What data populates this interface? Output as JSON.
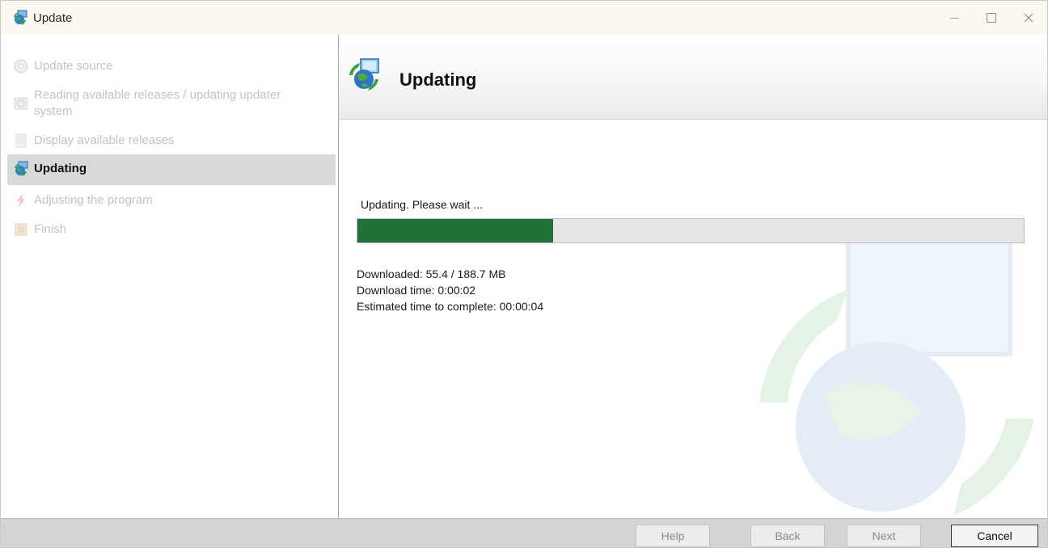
{
  "window": {
    "title": "Update"
  },
  "steps": [
    {
      "label": "Update source",
      "state": "disabled",
      "icon": "cd-icon"
    },
    {
      "label": "Reading available releases / updating updater system",
      "state": "disabled",
      "icon": "refresh-icon"
    },
    {
      "label": "Display available releases",
      "state": "disabled",
      "icon": "document-icon"
    },
    {
      "label": "Updating",
      "state": "active",
      "icon": "globe-update-icon"
    },
    {
      "label": "Adjusting the program",
      "state": "disabled",
      "icon": "lightning-icon"
    },
    {
      "label": "Finish",
      "state": "disabled",
      "icon": "finish-icon"
    }
  ],
  "header": {
    "title": "Updating"
  },
  "progress": {
    "status": "Updating. Please wait ...",
    "fraction": 0.294,
    "downloaded": "Downloaded: 55.4 / 188.7 MB",
    "download_time": "Download time: 0:00:02",
    "estimated": "Estimated time to complete: 00:00:04"
  },
  "buttons": {
    "help": "Help",
    "back": "Back",
    "next": "Next",
    "cancel": "Cancel"
  },
  "colors": {
    "progress_fill": "#21713b",
    "active_step_bg": "#d9d9d9"
  }
}
